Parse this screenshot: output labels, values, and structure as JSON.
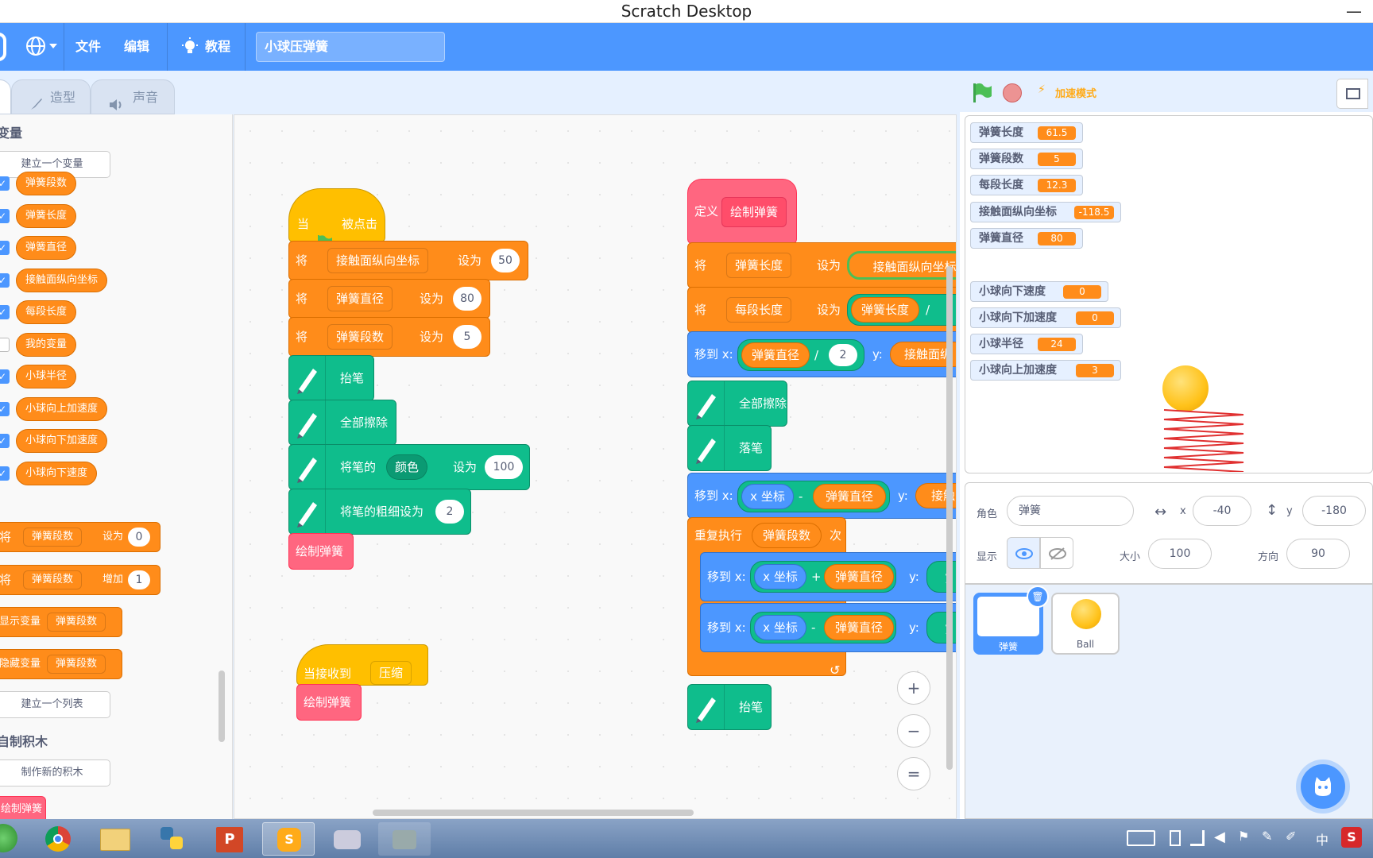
{
  "window": {
    "title": "Scratch Desktop",
    "minimize": "—"
  },
  "menu": {
    "file": "文件",
    "edit": "编辑",
    "tutorial": "教程",
    "project_title": "小球压弹簧"
  },
  "tabs": {
    "costumes": "造型",
    "sounds": "声音"
  },
  "palette": {
    "category_variables": "变量",
    "make_variable": "建立一个变量",
    "variables": [
      {
        "label": "弹簧段数",
        "checked": true
      },
      {
        "label": "弹簧长度",
        "checked": true
      },
      {
        "label": "弹簧直径",
        "checked": true
      },
      {
        "label": "接触面纵向坐标",
        "checked": true
      },
      {
        "label": "每段长度",
        "checked": true
      },
      {
        "label": "我的变量",
        "checked": false
      },
      {
        "label": "小球半径",
        "checked": true
      },
      {
        "label": "小球向上加速度",
        "checked": true
      },
      {
        "label": "小球向下加速度",
        "checked": true
      },
      {
        "label": "小球向下速度",
        "checked": true
      }
    ],
    "set_block": {
      "prefix": "将",
      "var": "弹簧段数",
      "op": "设为",
      "value": "0"
    },
    "change_block": {
      "prefix": "将",
      "var": "弹簧段数",
      "op": "增加",
      "value": "1"
    },
    "show_block": {
      "label": "显示变量",
      "var": "弹簧段数"
    },
    "hide_block": {
      "label": "隐藏变量",
      "var": "弹簧段数"
    },
    "make_list": "建立一个列表",
    "category_myblocks": "自制积木",
    "make_block": "制作新的积木",
    "custom_block": "绘制弹簧"
  },
  "script1": {
    "hat_when": "当",
    "hat_clicked": "被点击",
    "set1": {
      "prefix": "将",
      "var": "接触面纵向坐标",
      "op": "设为",
      "value": "50"
    },
    "set2": {
      "prefix": "将",
      "var": "弹簧直径",
      "op": "设为",
      "value": "80"
    },
    "set3": {
      "prefix": "将",
      "var": "弹簧段数",
      "op": "设为",
      "value": "5"
    },
    "pen_up": "抬笔",
    "clear": "全部擦除",
    "pen_color": {
      "prefix": "将笔的",
      "param": "颜色",
      "op": "设为",
      "value": "100"
    },
    "pen_size": {
      "label": "将笔的粗细设为",
      "value": "2"
    },
    "call": "绘制弹簧"
  },
  "script2": {
    "hat": "当接收到",
    "message": "压缩",
    "call": "绘制弹簧"
  },
  "script3": {
    "define": "定义",
    "define_name": "绘制弹簧",
    "set1": {
      "prefix": "将",
      "var": "弹簧长度",
      "op": "设为",
      "reporter": "接触面纵向坐标"
    },
    "set2": {
      "prefix": "将",
      "var": "每段长度",
      "op": "设为",
      "reporter": "弹簧长度",
      "operator": "/"
    },
    "goto1": {
      "label": "移到 x:",
      "left": "弹簧直径",
      "operator": "/",
      "right": "2",
      "y": "y:",
      "yreporter": "接触面纵"
    },
    "clear": "全部擦除",
    "pen_down": "落笔",
    "goto2": {
      "label": "移到 x:",
      "left": "x 坐标",
      "operator": "-",
      "right": "弹簧直径",
      "y": "y:",
      "yreporter": "接触"
    },
    "repeat": {
      "label": "重复执行",
      "count": "弹簧段数",
      "suffix": "次"
    },
    "goto3": {
      "label": "移到 x:",
      "left": "x 坐标",
      "operator": "+",
      "right": "弹簧直径",
      "y": "y:",
      "yreporter": "y"
    },
    "goto4": {
      "label": "移到 x:",
      "left": "x 坐标",
      "operator": "-",
      "right": "弹簧直径",
      "y": "y:",
      "yreporter": "y"
    },
    "pen_up": "抬笔"
  },
  "stage_header": {
    "turbo": "加速模式"
  },
  "monitors": [
    {
      "label": "弹簧长度",
      "value": "61.5"
    },
    {
      "label": "弹簧段数",
      "value": "5"
    },
    {
      "label": "每段长度",
      "value": "12.3"
    },
    {
      "label": "接触面纵向坐标",
      "value": "-118.5"
    },
    {
      "label": "弹簧直径",
      "value": "80"
    },
    {
      "label": "小球向下速度",
      "value": "0"
    },
    {
      "label": "小球向下加速度",
      "value": "0"
    },
    {
      "label": "小球半径",
      "value": "24"
    },
    {
      "label": "小球向上加速度",
      "value": "3"
    }
  ],
  "sprite_info": {
    "sprite_label": "角色",
    "sprite_name": "弹簧",
    "x_label": "x",
    "x": "-40",
    "y_label": "y",
    "y": "-180",
    "show_label": "显示",
    "size_label": "大小",
    "size": "100",
    "direction_label": "方向",
    "direction": "90"
  },
  "sprites": [
    {
      "name": "弹簧"
    },
    {
      "name": "Ball"
    }
  ],
  "taskbar": {
    "ime": "中"
  },
  "colors": {
    "accent": "#4c97ff",
    "variables": "#ff8c1a",
    "events": "#ffbf00",
    "pen": "#0fbd8c",
    "myblocks": "#ff6680",
    "motion": "#4c97ff"
  }
}
